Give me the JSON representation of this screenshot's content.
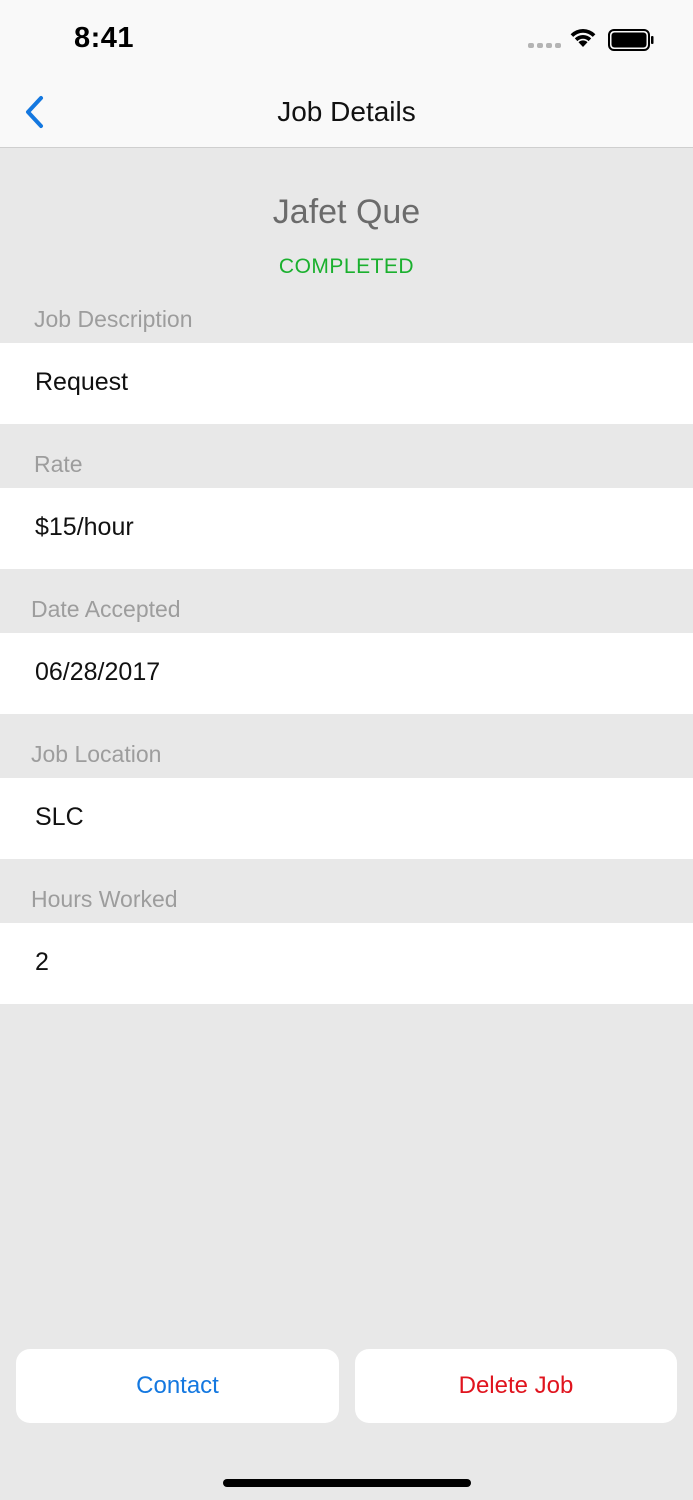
{
  "status_bar": {
    "time": "8:41"
  },
  "nav": {
    "title": "Job Details",
    "back_icon": "chevron-left-icon"
  },
  "header": {
    "name": "Jafet Que",
    "status": "COMPLETED",
    "status_color": "#1ab02e"
  },
  "fields": {
    "job_description": {
      "label": "Job Description",
      "value": "Request"
    },
    "rate": {
      "label": "Rate",
      "value": "$15/hour"
    },
    "date_accepted": {
      "label": "Date Accepted",
      "value": "06/28/2017"
    },
    "job_location": {
      "label": "Job Location",
      "value": "SLC"
    },
    "hours_worked": {
      "label": "Hours Worked",
      "value": "2"
    }
  },
  "actions": {
    "contact_label": "Contact",
    "delete_label": "Delete Job"
  },
  "colors": {
    "accent": "#1478e0",
    "destructive": "#e0141e",
    "background": "#e8e8e8"
  }
}
